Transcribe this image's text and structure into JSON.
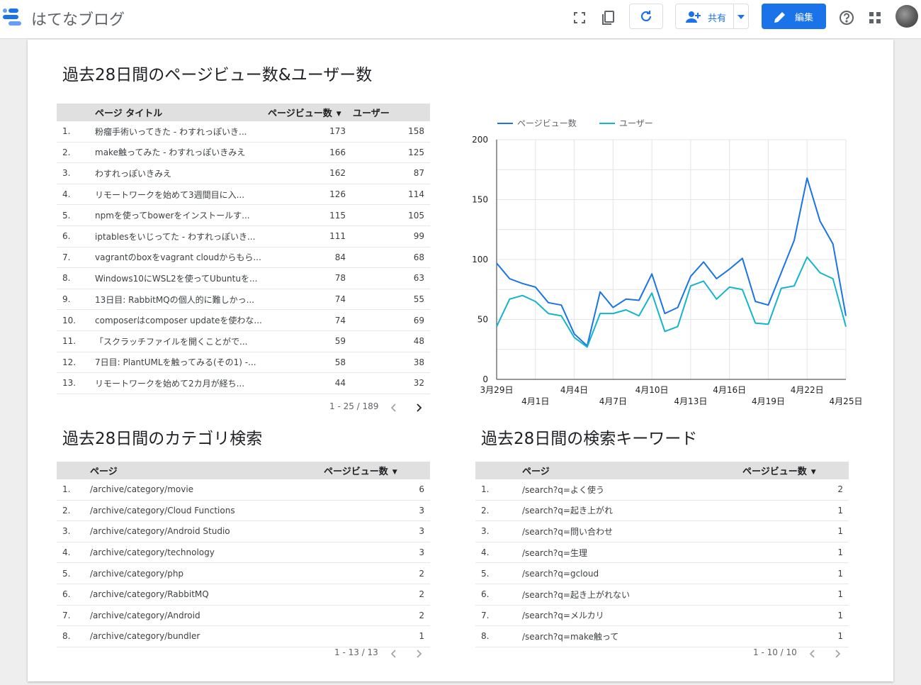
{
  "header": {
    "app_title": "はてなブログ",
    "share_label": "共有",
    "edit_label": "編集"
  },
  "sections": {
    "top_title": "過去28日間のページビュー数&ユーザー数",
    "category_title": "過去28日間のカテゴリ検索",
    "keyword_title": "過去28日間の検索キーワード"
  },
  "pages_table": {
    "headers": [
      "ページ タイトル",
      "ページビュー数",
      "ユーザー"
    ],
    "rows": [
      [
        "1.",
        "粉瘤手術いってきた - わすれっぽいき...",
        "173",
        "158"
      ],
      [
        "2.",
        "make触ってみた - わすれっぽいきみえ",
        "166",
        "125"
      ],
      [
        "3.",
        "わすれっぽいきみえ",
        "162",
        "87"
      ],
      [
        "4.",
        "リモートワークを始めて3週間目に入...",
        "126",
        "114"
      ],
      [
        "5.",
        "npmを使ってbowerをインストールす...",
        "115",
        "105"
      ],
      [
        "6.",
        "iptablesをいじってた - わすれっぽいき...",
        "111",
        "99"
      ],
      [
        "7.",
        "vagrantのboxをvagrant cloudからもら...",
        "84",
        "68"
      ],
      [
        "8.",
        "Windows10にWSL2を使ってUbuntuを...",
        "78",
        "63"
      ],
      [
        "9.",
        "13日目: RabbitMQの個人的に難しかっ...",
        "74",
        "55"
      ],
      [
        "10.",
        "composerはcomposer updateを使わな...",
        "74",
        "69"
      ],
      [
        "11.",
        "「スクラッチファイルを開くことがで...",
        "59",
        "48"
      ],
      [
        "12.",
        "7日目: PlantUMLを触ってみる(その1) -...",
        "58",
        "38"
      ],
      [
        "13.",
        "リモートワークを始めて2カ月が経ち...",
        "44",
        "32"
      ]
    ],
    "pagination": "1 - 25 / 189"
  },
  "category_table": {
    "headers": [
      "ページ",
      "ページビュー数"
    ],
    "rows": [
      [
        "1.",
        "/archive/category/movie",
        "6"
      ],
      [
        "2.",
        "/archive/category/Cloud Functions",
        "3"
      ],
      [
        "3.",
        "/archive/category/Android Studio",
        "3"
      ],
      [
        "4.",
        "/archive/category/technology",
        "3"
      ],
      [
        "5.",
        "/archive/category/php",
        "2"
      ],
      [
        "6.",
        "/archive/category/RabbitMQ",
        "2"
      ],
      [
        "7.",
        "/archive/category/Android",
        "2"
      ],
      [
        "8.",
        "/archive/category/bundler",
        "1"
      ]
    ],
    "pagination": "1 - 13 / 13"
  },
  "keyword_table": {
    "headers": [
      "ページ",
      "ページビュー数"
    ],
    "rows": [
      [
        "1.",
        "/search?q=よく使う",
        "2"
      ],
      [
        "2.",
        "/search?q=起き上がれ",
        "1"
      ],
      [
        "3.",
        "/search?q=問い合わせ",
        "1"
      ],
      [
        "4.",
        "/search?q=生理",
        "1"
      ],
      [
        "5.",
        "/search?q=gcloud",
        "1"
      ],
      [
        "6.",
        "/search?q=起き上がれない",
        "1"
      ],
      [
        "7.",
        "/search?q=メルカリ",
        "1"
      ],
      [
        "8.",
        "/search?q=make触って",
        "1"
      ]
    ],
    "pagination": "1 - 10 / 10"
  },
  "colors": {
    "accent": "#1a73e8",
    "series_pageviews": "#1a73e8",
    "series_users": "#12b5cb"
  },
  "chart_data": {
    "type": "line",
    "x": [
      "3月29日",
      "3月30日",
      "3月31日",
      "4月1日",
      "4月2日",
      "4月3日",
      "4月4日",
      "4月5日",
      "4月6日",
      "4月7日",
      "4月8日",
      "4月9日",
      "4月10日",
      "4月11日",
      "4月12日",
      "4月13日",
      "4月14日",
      "4月15日",
      "4月16日",
      "4月17日",
      "4月18日",
      "4月19日",
      "4月20日",
      "4月21日",
      "4月22日",
      "4月23日",
      "4月24日",
      "4月25日"
    ],
    "x_tick_labels_upper": [
      "3月29日",
      "4月4日",
      "4月10日",
      "4月16日",
      "4月22日"
    ],
    "x_tick_labels_lower": [
      "4月1日",
      "4月7日",
      "4月13日",
      "4月19日",
      "4月25日"
    ],
    "series": [
      {
        "name": "ページビュー数",
        "values": [
          97,
          84,
          80,
          77,
          64,
          62,
          38,
          28,
          73,
          60,
          67,
          66,
          88,
          55,
          60,
          86,
          98,
          84,
          92,
          101,
          65,
          62,
          89,
          116,
          168,
          132,
          113,
          53
        ]
      },
      {
        "name": "ユーザー",
        "values": [
          44,
          67,
          70,
          65,
          55,
          53,
          35,
          27,
          55,
          55,
          58,
          53,
          72,
          40,
          44,
          78,
          82,
          67,
          77,
          75,
          47,
          46,
          76,
          78,
          102,
          89,
          84,
          44
        ]
      }
    ],
    "ylim": [
      0,
      200
    ],
    "yticks": [
      0,
      50,
      100,
      150,
      200
    ],
    "legend": "top",
    "grid": true
  }
}
